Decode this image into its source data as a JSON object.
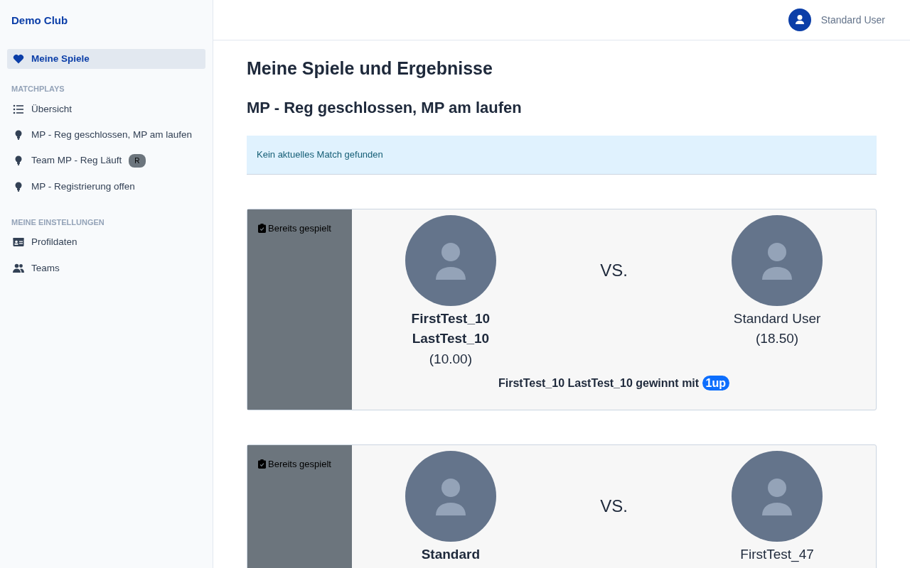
{
  "brand": "Demo Club",
  "sidebar": {
    "items": [
      {
        "kind": "heart",
        "label": "Meine Spiele",
        "selected": true
      }
    ],
    "sections": [
      {
        "title": "MATCHPLAYS",
        "items": [
          {
            "kind": "list",
            "label": "Übersicht",
            "selected": false
          },
          {
            "kind": "bulb",
            "label": "MP - Reg geschlossen, MP am laufen",
            "selected": false
          },
          {
            "kind": "bulb",
            "label": "Team MP - Reg Läuft",
            "badge": "R",
            "selected": false
          },
          {
            "kind": "bulb",
            "label": "MP - Registrierung offen",
            "selected": false
          }
        ]
      },
      {
        "title": "MEINE EINSTELLUNGEN",
        "items": [
          {
            "kind": "idcard",
            "label": "Profildaten",
            "selected": false
          },
          {
            "kind": "users",
            "label": "Teams",
            "selected": false
          }
        ]
      }
    ]
  },
  "user": {
    "name": "Standard User"
  },
  "page_title": "Meine Spiele und Ergebnisse",
  "section_title": "MP - Reg geschlossen, MP am laufen",
  "alert": "Kein aktuelles Match gefunden",
  "matches": [
    {
      "status": "Bereits gespielt",
      "vs": "VS.",
      "players": [
        {
          "name": "FirstTest_10 LastTest_10",
          "hcp": "(10.00)",
          "winner": true
        },
        {
          "name": "Standard User",
          "hcp": "(18.50)",
          "winner": false
        }
      ],
      "result": "FirstTest_10 LastTest_10 gewinnt mit",
      "score": "1up"
    },
    {
      "status": "Bereits gespielt",
      "vs": "VS.",
      "players": [
        {
          "name": "Standard",
          "winner": true
        },
        {
          "name": "FirstTest_47",
          "winner": false
        }
      ]
    }
  ]
}
